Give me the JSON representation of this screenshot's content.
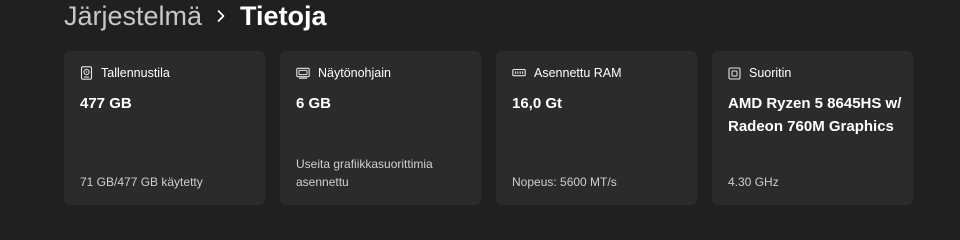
{
  "breadcrumb": {
    "parent": "Järjestelmä",
    "current": "Tietoja"
  },
  "cards": [
    {
      "icon": "storage-icon",
      "title": "Tallennustila",
      "value": "477 GB",
      "detail": "71 GB/477 GB käytetty"
    },
    {
      "icon": "gpu-icon",
      "title": "Näytönohjain",
      "value": "6 GB",
      "detail": "Useita grafiikkasuorittimia asennettu"
    },
    {
      "icon": "ram-icon",
      "title": "Asennettu RAM",
      "value": "16,0 Gt",
      "detail": "Nopeus: 5600 MT/s"
    },
    {
      "icon": "processor-icon",
      "title": "Suoritin",
      "value": "AMD Ryzen 5 8645HS w/ Radeon 760M Graphics",
      "detail": "4.30 GHz"
    }
  ]
}
